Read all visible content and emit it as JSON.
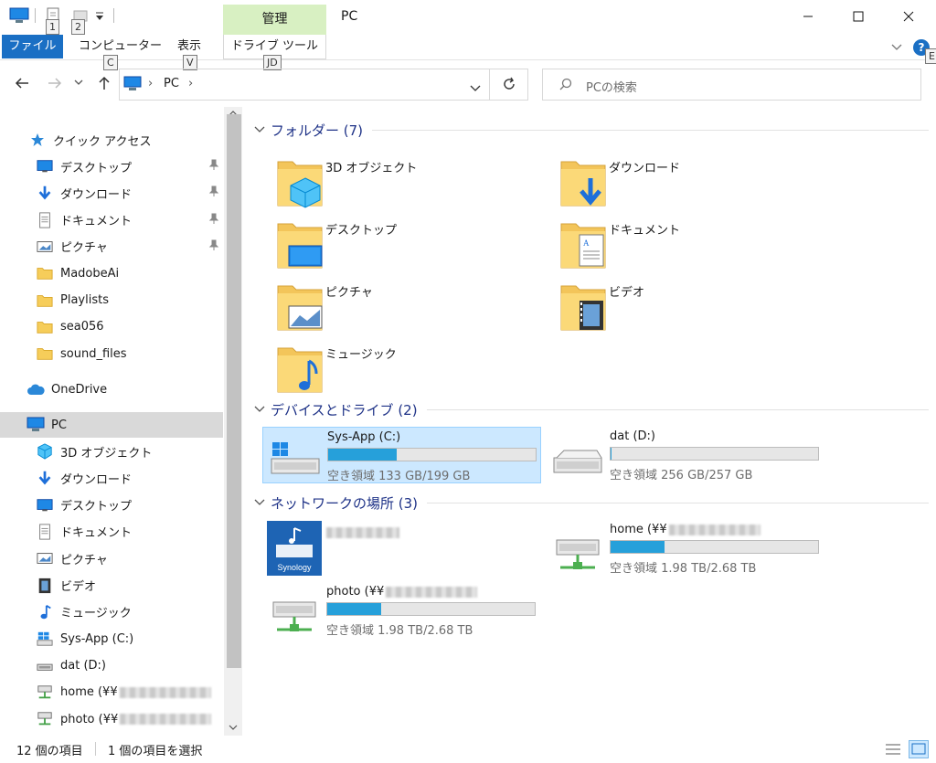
{
  "window": {
    "title": "PC",
    "manage_tab": "管理",
    "keytips": {
      "qa1": "1",
      "qa2": "2",
      "computer": "C",
      "view": "V",
      "drive": "JD",
      "help": "E"
    }
  },
  "ribbon": {
    "file": "ファイル",
    "computer": "コンピューター",
    "view": "表示",
    "drive_tools": "ドライブ ツール"
  },
  "nav": {
    "path_root": "PC",
    "search_placeholder": "PCの検索"
  },
  "sidebar": {
    "quick_access": "クイック アクセス",
    "qa_items": [
      {
        "label": "デスクトップ",
        "icon": "desktop-icon",
        "pinned": true
      },
      {
        "label": "ダウンロード",
        "icon": "download-icon",
        "pinned": true
      },
      {
        "label": "ドキュメント",
        "icon": "document-icon",
        "pinned": true
      },
      {
        "label": "ピクチャ",
        "icon": "picture-icon",
        "pinned": true
      },
      {
        "label": "MadobeAi",
        "icon": "folder-icon",
        "pinned": false
      },
      {
        "label": "Playlists",
        "icon": "folder-icon",
        "pinned": false
      },
      {
        "label": "sea056",
        "icon": "folder-icon",
        "pinned": false
      },
      {
        "label": "sound_files",
        "icon": "folder-icon",
        "pinned": false
      }
    ],
    "onedrive": "OneDrive",
    "pc": "PC",
    "pc_items": [
      {
        "label": "3D オブジェクト",
        "icon": "3d-objects-icon"
      },
      {
        "label": "ダウンロード",
        "icon": "download-icon"
      },
      {
        "label": "デスクトップ",
        "icon": "desktop-icon"
      },
      {
        "label": "ドキュメント",
        "icon": "document-icon"
      },
      {
        "label": "ピクチャ",
        "icon": "picture-icon"
      },
      {
        "label": "ビデオ",
        "icon": "video-icon"
      },
      {
        "label": "ミュージック",
        "icon": "music-icon"
      },
      {
        "label": "Sys-App (C:)",
        "icon": "windows-drive-icon"
      },
      {
        "label": "dat (D:)",
        "icon": "drive-icon"
      },
      {
        "label": "home (¥¥",
        "icon": "network-drive-icon"
      },
      {
        "label": "photo (¥¥",
        "icon": "network-drive-icon"
      }
    ]
  },
  "main": {
    "folders_header": "フォルダー (7)",
    "folders": [
      {
        "label": "3D オブジェクト",
        "icon": "3d-objects-folder-icon"
      },
      {
        "label": "ダウンロード",
        "icon": "download-folder-icon"
      },
      {
        "label": "デスクトップ",
        "icon": "desktop-folder-icon"
      },
      {
        "label": "ドキュメント",
        "icon": "document-folder-icon"
      },
      {
        "label": "ピクチャ",
        "icon": "picture-folder-icon"
      },
      {
        "label": "ビデオ",
        "icon": "video-folder-icon"
      },
      {
        "label": "ミュージック",
        "icon": "music-folder-icon"
      }
    ],
    "devices_header": "デバイスとドライブ (2)",
    "drives": [
      {
        "name": "Sys-App (C:)",
        "free": "空き領域 133 GB/199 GB",
        "used_fraction": 0.33,
        "selected": true,
        "icon": "windows-drive-icon"
      },
      {
        "name": "dat (D:)",
        "free": "空き領域 256 GB/257 GB",
        "used_fraction": 0.004,
        "selected": false,
        "icon": "drive-icon"
      }
    ],
    "network_header": "ネットワークの場所 (3)",
    "network": [
      {
        "name": "",
        "icon": "synology-icon"
      },
      {
        "name": "home (¥¥",
        "free": "空き領域 1.98 TB/2.68 TB",
        "used_fraction": 0.26,
        "icon": "network-drive-icon"
      },
      {
        "name": "photo (¥¥",
        "free": "空き領域 1.98 TB/2.68 TB",
        "used_fraction": 0.26,
        "icon": "network-drive-icon"
      }
    ]
  },
  "status": {
    "items": "12 個の項目",
    "selected": "1 個の項目を選択"
  },
  "colors": {
    "accent": "#1a6fc4",
    "selection": "#cce8ff",
    "bar": "#26a0da",
    "manage": "#d8f0c2",
    "header": "#1e3287"
  }
}
